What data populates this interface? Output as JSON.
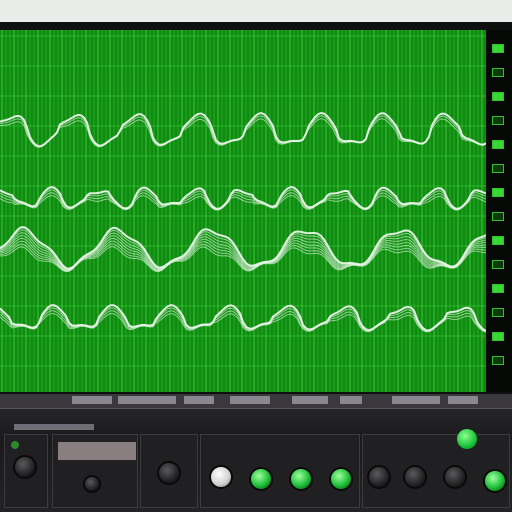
{
  "colors": {
    "screen_bg": "#108a10",
    "grid_line": "#3fd13f",
    "trace": "#e8f6e8",
    "console_bg": "#1f1e21",
    "accent_led": "#2ee82e"
  },
  "traces": {
    "count": 4
  },
  "side_indicators": {
    "count": 14,
    "lit": [
      0,
      2,
      4,
      6,
      8,
      10,
      12
    ]
  },
  "console": {
    "knob_states": [
      "off",
      "off",
      "white",
      "lit",
      "lit",
      "lit",
      "off",
      "off",
      "off",
      "lit"
    ]
  }
}
